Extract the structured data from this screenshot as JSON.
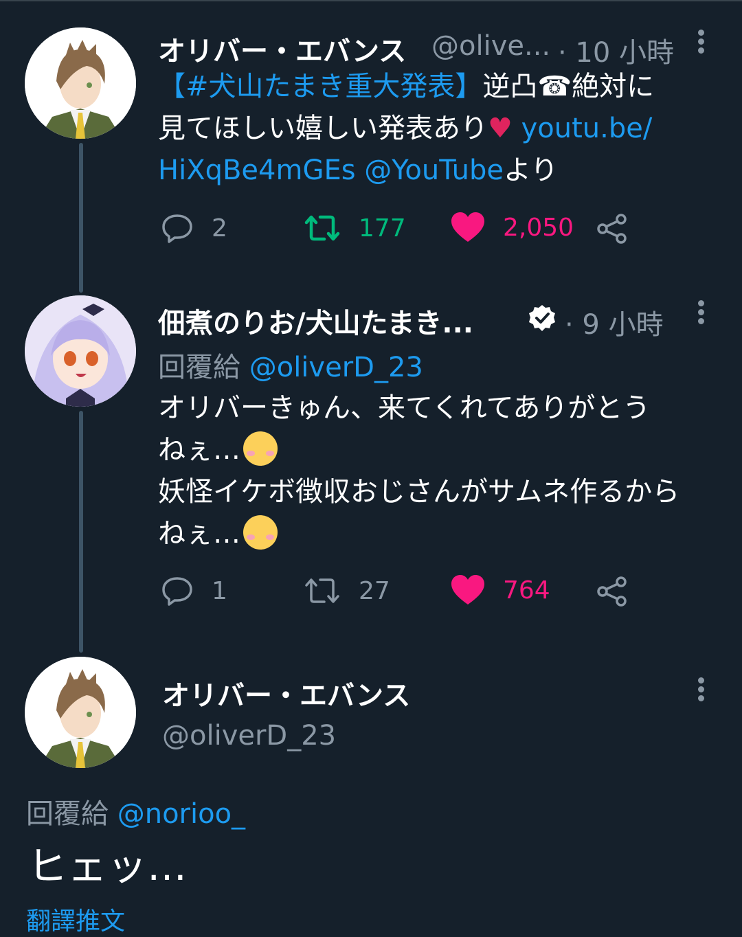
{
  "tweet1": {
    "name": "オリバー・エバンス",
    "handle": "@olive...",
    "time": "· 10 小時",
    "hashtag": "【#犬山たまき重大発表】",
    "text_a": "逆凸☎絶対に",
    "text_b": "見てほしい嬉しい発表あり",
    "heart_emoji": "♥",
    "link_a": "youtu.be/",
    "link_b": "HiXqBe4mGEs",
    "mention": "@YouTube",
    "text_c": "より",
    "replies": "2",
    "retweets": "177",
    "likes": "2,050"
  },
  "tweet2": {
    "name": "佃煮のりお/犬山たまき...",
    "time": "· 9 小時",
    "reply_label": "回覆給",
    "reply_to": "@oliverD_23",
    "line1": "オリバーきゅん、来てくれてありがとう",
    "line2": "ねぇ…",
    "line3": "妖怪イケボ徴収おじさんがサムネ作るから",
    "line4": "ねぇ…",
    "replies": "1",
    "retweets": "27",
    "likes": "764"
  },
  "tweet3": {
    "name": "オリバー・エバンス",
    "handle": "@oliverD_23",
    "reply_label": "回覆給",
    "reply_to": "@norioo_",
    "text": "ヒェッ…",
    "translate": "翻譯推文"
  },
  "icons": {
    "reply": "reply-icon",
    "retweet": "retweet-icon",
    "like": "heart-icon",
    "share": "share-icon",
    "verified": "verified-badge-icon",
    "more": "more-options-icon"
  },
  "colors": {
    "background": "#15202b",
    "link": "#1d9bf0",
    "retweet_active": "#00ba7c",
    "like_active": "#f91880",
    "muted": "#8b98a5"
  }
}
